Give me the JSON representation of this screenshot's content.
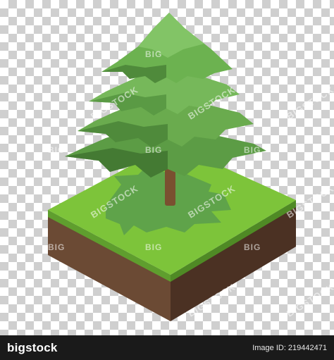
{
  "watermark": {
    "big_label": "BIG",
    "stock_label": "BIGSTOCK"
  },
  "footer": {
    "logo_text": "bigstock",
    "image_id": "Image ID: 219442471"
  },
  "colors": {
    "grass_top": "#7dc43a",
    "grass_shadow": "#5fa34a",
    "soil_left": "#6b4a34",
    "soil_right": "#4b3123",
    "trunk": "#7a5030",
    "foliage_light": "#76b85a",
    "foliage_mid": "#5c9c45",
    "foliage_dark": "#447a33",
    "footer_bg": "#1a1a1a"
  }
}
